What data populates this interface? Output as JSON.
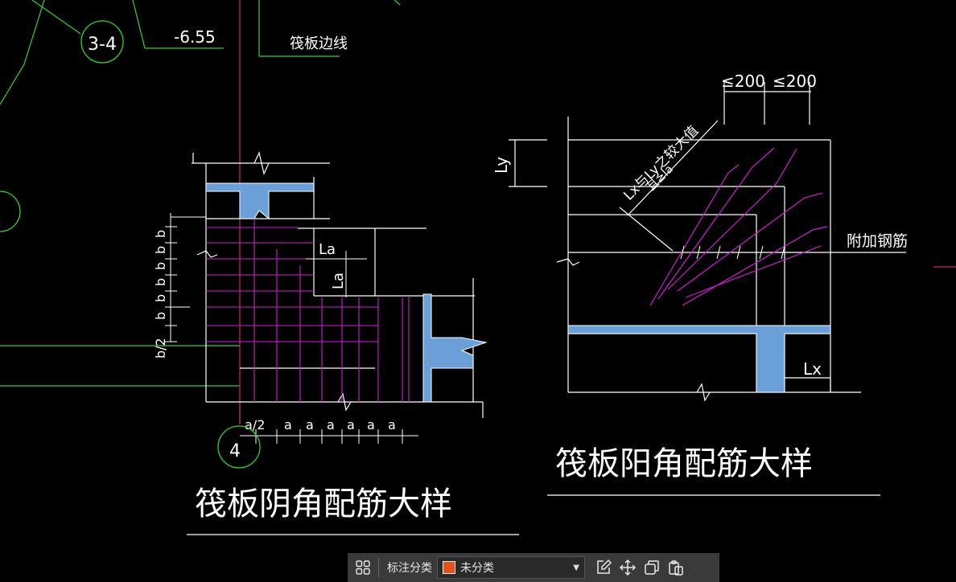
{
  "drawing": {
    "left_detail": {
      "title": "筏板阴角配筋大样",
      "axis_label_left": "3-4",
      "axis_label_bottom": "4",
      "elevation": "-6.55",
      "edge_label": "筏板边线",
      "la_h": "La",
      "la_v": "La",
      "dim_b_half": "b/2",
      "dim_b": [
        "b",
        "b",
        "b",
        "b",
        "b",
        "b"
      ],
      "dim_a_half": "a/2",
      "dim_a": [
        "a",
        "a",
        "a",
        "a",
        "a",
        "a"
      ]
    },
    "right_detail": {
      "title": "筏板阳角配筋大样",
      "dim_top_1": "≤200",
      "dim_top_2": "≤200",
      "ly": "Ly",
      "lx": "Lx",
      "diag_1": "Lx与Ly之较大值",
      "diag_2": "且≥la",
      "extra_rebar": "附加钢筋"
    },
    "colors": {
      "background": "#000000",
      "line": "#ffffff",
      "rebar": "#d01ed0",
      "concrete": "#6a9fd8",
      "axis": "#2fd42f",
      "axis_red": "#d02070",
      "leader": "#d8d870"
    }
  },
  "toolbar": {
    "grid_icon": "grid-icon",
    "category_label": "标注分类",
    "category_value": "未分类",
    "category_color": "#e8501a",
    "actions": [
      "edit-icon",
      "move-icon",
      "copy-icon",
      "paste-icon"
    ]
  }
}
